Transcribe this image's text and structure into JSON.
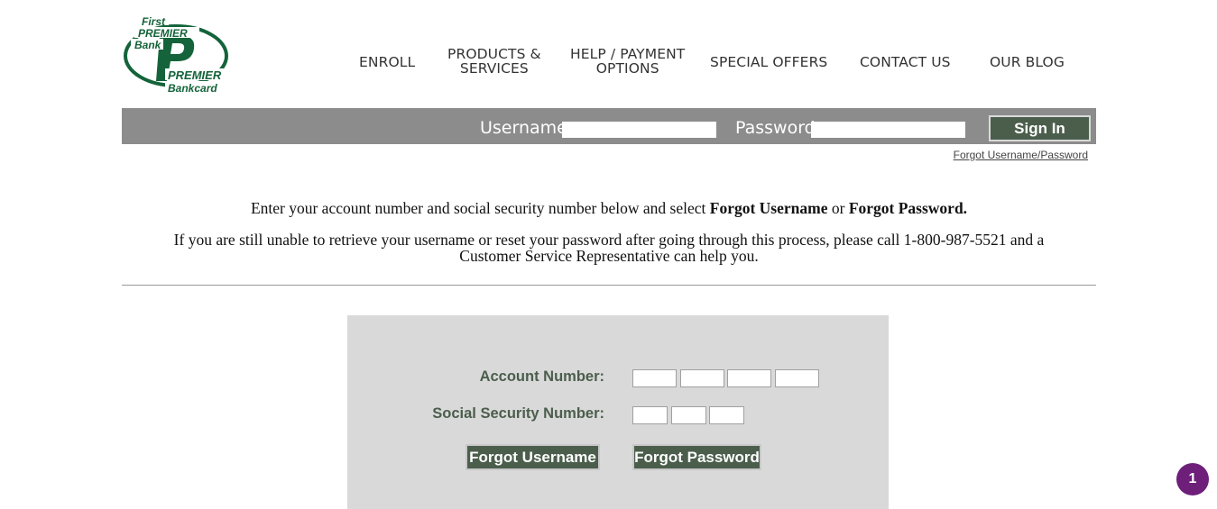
{
  "logo": {
    "line1": "First",
    "line2": "PREMIER",
    "line3": "Bank",
    "line4": "PREMIER",
    "line5": "Bankcard",
    "brand_color": "#14633a"
  },
  "nav": {
    "enroll": "ENROLL",
    "products_line1": "PRODUCTS &",
    "products_line2": "SERVICES",
    "help_line1": "HELP / PAYMENT",
    "help_line2": "OPTIONS",
    "special_offers": "SPECIAL OFFERS",
    "contact_us": "CONTACT US",
    "our_blog": "OUR BLOG"
  },
  "login": {
    "username_label": "Username:",
    "username_value": "",
    "password_label": "Password:",
    "password_value": "",
    "sign_in": "Sign In",
    "forgot_link": "Forgot Username/Password"
  },
  "instructions": {
    "line1_prefix": "Enter your account number and social security number below and select ",
    "forgot_username_bold": "Forgot Username",
    "or": " or ",
    "forgot_password_bold": "Forgot Password.",
    "line2a": "If you are still unable to retrieve your username or reset your password after going through this process, please call 1-800-987-5521 and a",
    "line2b": "Customer Service Representative can help you."
  },
  "form": {
    "account_label": "Account Number:",
    "ssn_label": "Social Security Number:",
    "forgot_username_btn": "Forgot Username",
    "forgot_password_btn": "Forgot Password"
  },
  "badge": {
    "count": "1",
    "color": "#6d1f7a"
  },
  "colors": {
    "login_bar": "#8c8c8c",
    "button_green": "#4b5e4c",
    "panel_bg": "#d9d9d9"
  }
}
